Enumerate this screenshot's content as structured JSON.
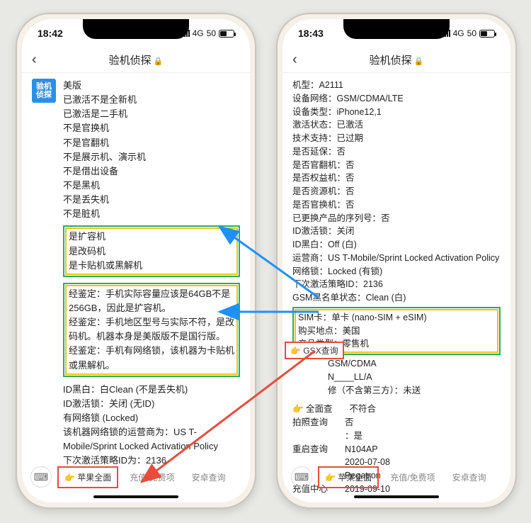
{
  "statusbar": {
    "time_left": "18:42",
    "time_right": "18:43",
    "net": "4G",
    "batt": "50"
  },
  "navbar": {
    "title": "验机侦探",
    "lock": "🔒"
  },
  "app_badge": "验机\n侦探",
  "left_msg": {
    "header": "美版",
    "lines": [
      "已激活不是全新机",
      "已激活是二手机",
      "不是官换机",
      "不是官翻机",
      "不是展示机、演示机",
      "不是借出设备",
      "不是黑机",
      "不是丢失机",
      "不是脏机"
    ],
    "box1": [
      "是扩容机",
      "是改码机",
      "是卡贴机或黑解机"
    ],
    "box2": [
      "经鉴定：手机实际容量应该是64GB不是256GB，因此是扩容机。",
      "经鉴定：手机地区型号与实际不符，是改码机。机器本身是美版版不是国行版。",
      "经鉴定：手机有网络锁，该机器为卡贴机或黑解机。"
    ],
    "tail": [
      "ID黑白：白Clean (不是丢失机)",
      "ID激活锁：关闭 (无ID)",
      "有网络锁 (Locked)",
      "该机器网络锁的运营商为：US T-Mobile/Sprint Locked Activation Policy",
      "下次激活策略ID为：2136"
    ]
  },
  "right_msg": {
    "top": [
      "机型：A2111",
      "设备网络：GSM/CDMA/LTE",
      "设备类型：iPhone12,1",
      "激活状态：已激活",
      "技术支持：已过期",
      "是否延保：否",
      "是否官翻机：否",
      "是否权益机：否",
      "是否资源机：否",
      "是否官换机：否",
      "已更换产品的序列号：否",
      "ID激活锁：关闭",
      "ID黑白：Off (白)",
      "运营商：US T-Mobile/Sprint Locked Activation Policy",
      "网络锁：Locked (有锁)",
      "下次激活策略ID：2136",
      "GSM黑名单状态：Clean (白)"
    ],
    "box": [
      "SIM卡：单卡 (nano-SIM + eSIM)",
      "购买地点：美国",
      "产品类型：零售机"
    ],
    "after": [
      "GSM/CDMA",
      "N____LL/A",
      "修（不含第三方）：未送"
    ],
    "kvs": [
      {
        "k": "👉 全面查",
        "v": "不符合"
      },
      {
        "k": "拍照查询",
        "v": "否\n：是"
      },
      {
        "k": "重启查询",
        "v": "N104AP\n2020-07-08\nPegatron"
      },
      {
        "k": "充值中心",
        "v": "2019-09-10"
      }
    ]
  },
  "tabs": {
    "active": "👉 苹果全面",
    "t2": "充值/免费项",
    "t3": "安卓查询"
  },
  "gsx": "👉 GSX查询"
}
